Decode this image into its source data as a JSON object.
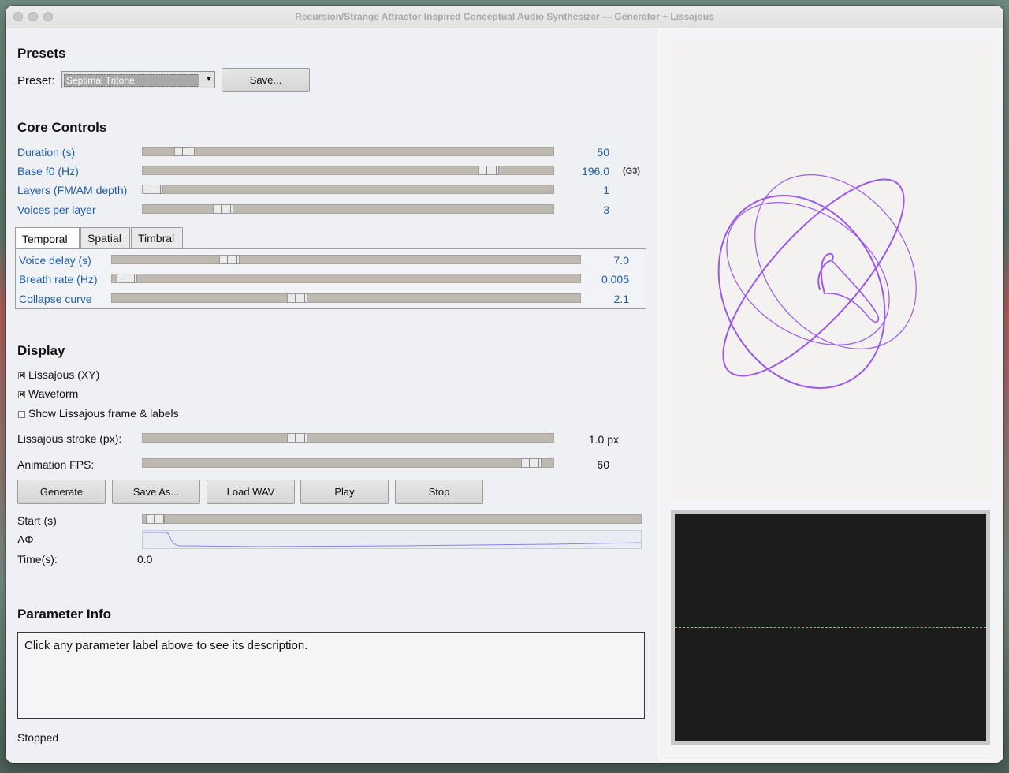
{
  "window": {
    "title": "Recursion/Strange Attractor Inspired Conceptual Audio Synthesizer — Generator + Lissajous"
  },
  "presets": {
    "heading": "Presets",
    "label": "Preset:",
    "selected": "Septimal Tritone",
    "save_label": "Save..."
  },
  "core": {
    "heading": "Core Controls",
    "sliders": [
      {
        "label": "Duration (s)",
        "value": "50",
        "level": 0.08
      },
      {
        "label": "Base f0 (Hz)",
        "value": "196.0",
        "note": "(G3)",
        "level": 0.86
      },
      {
        "label": "Layers (FM/AM depth)",
        "value": "1",
        "level": 0.0
      },
      {
        "label": "Voices per layer",
        "value": "3",
        "level": 0.18
      }
    ]
  },
  "tabs": {
    "items": [
      "Temporal",
      "Spatial",
      "Timbral"
    ],
    "active": "Temporal",
    "sliders": [
      {
        "label": "Voice delay (s)",
        "value": "7.0",
        "level": 0.24
      },
      {
        "label": "Breath rate (Hz)",
        "value": "0.005",
        "level": 0.01
      },
      {
        "label": "Collapse curve",
        "value": "2.1",
        "level": 0.39
      }
    ]
  },
  "display": {
    "heading": "Display",
    "checkboxes": [
      {
        "label": "Lissajous (XY)",
        "checked": true
      },
      {
        "label": "Waveform",
        "checked": true
      },
      {
        "label": "Show Lissajous frame & labels",
        "checked": false
      }
    ],
    "stroke": {
      "label": "Lissajous stroke (px):",
      "value": "1.0 px",
      "level": 0.37
    },
    "fps": {
      "label": "Animation FPS:",
      "value": "60",
      "level": 0.97
    }
  },
  "actions": {
    "generate": "Generate",
    "save_as": "Save As...",
    "load_wav": "Load WAV",
    "play": "Play",
    "stop": "Stop"
  },
  "playback": {
    "start_label": "Start (s)",
    "start_level": 0.0,
    "delta_label": "ΔΦ",
    "time_label": "Time(s):",
    "time_value": "0.0"
  },
  "info": {
    "heading": "Parameter Info",
    "text": "Click any parameter label above to see its description."
  },
  "status": "Stopped",
  "colors": {
    "lissajous": "#9b59e6",
    "waveform": "#3fe07a",
    "scope_bg": "#1c1c1c",
    "label_blue": "#1f5ea8"
  }
}
